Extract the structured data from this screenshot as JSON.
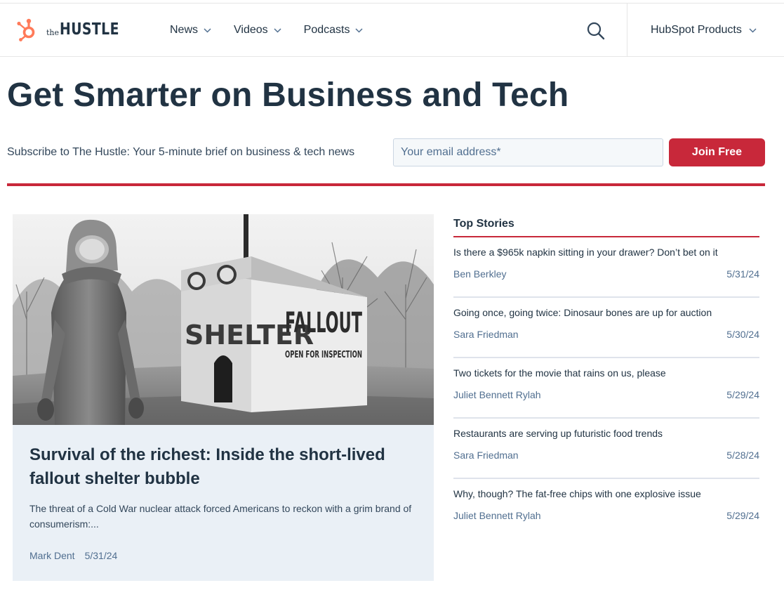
{
  "brand": {
    "logo_the": "the",
    "logo_hustle": "HUSTLE",
    "logo_icon": "hubspot-sprocket-icon",
    "accent_color": "#c8283a",
    "brand_orange": "#ff7a59"
  },
  "nav": {
    "items": [
      {
        "label": "News"
      },
      {
        "label": "Videos"
      },
      {
        "label": "Podcasts"
      }
    ],
    "search_icon": "search-icon",
    "products_label": "HubSpot Products"
  },
  "hero": {
    "headline": "Get Smarter on Business and Tech",
    "subscribe_text": "Subscribe to The Hustle: Your 5-minute brief on business & tech news",
    "email_placeholder": "Your email address*",
    "join_label": "Join Free"
  },
  "featured": {
    "image_sign_left": "SHELTER",
    "image_sign_right": "FALLOUT",
    "image_sign_sub": "OPEN FOR INSPECTION",
    "title": "Survival of the richest: Inside the short-lived fallout shelter bubble",
    "description": "The threat of a Cold War nuclear attack forced Americans to reckon with a grim brand of consumerism:...",
    "author": "Mark Dent",
    "date": "5/31/24"
  },
  "top_stories": {
    "heading": "Top Stories",
    "items": [
      {
        "title": "Is there a $965k napkin sitting in your drawer? Don’t bet on it",
        "author": "Ben Berkley",
        "date": "5/31/24"
      },
      {
        "title": "Going once, going twice: Dinosaur bones are up for auction",
        "author": "Sara Friedman",
        "date": "5/30/24"
      },
      {
        "title": "Two tickets for the movie that rains on us, please",
        "author": "Juliet Bennett Rylah",
        "date": "5/29/24"
      },
      {
        "title": "Restaurants are serving up futuristic food trends",
        "author": "Sara Friedman",
        "date": "5/28/24"
      },
      {
        "title": "Why, though? The fat-free chips with one explosive issue",
        "author": "Juliet Bennett Rylah",
        "date": "5/29/24"
      }
    ]
  }
}
